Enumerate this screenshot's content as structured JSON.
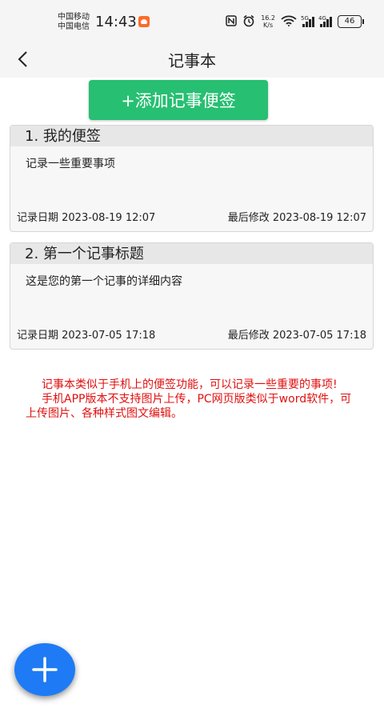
{
  "status_bar": {
    "carrier_1": "中国移动",
    "carrier_2": "中国电信",
    "time": "14:43",
    "speed_value": "16.2",
    "speed_unit": "K/s",
    "signal_1_label": "5G",
    "signal_2_label": "4G",
    "battery": "46"
  },
  "header": {
    "title": "记事本"
  },
  "add_button": {
    "label": "+添加记事便签",
    "color": "#27bf72"
  },
  "notes": [
    {
      "title": "1. 我的便签",
      "content": "记录一些重要事项",
      "record_date": "记录日期 2023-08-19 12:07",
      "modified_date": "最后修改 2023-08-19 12:07"
    },
    {
      "title": "2. 第一个记事标题",
      "content": "这是您的第一个记事的详细内容",
      "record_date": "记录日期 2023-07-05 17:18",
      "modified_date": "最后修改 2023-07-05 17:18"
    }
  ],
  "info": {
    "paragraph_1": "记事本类似于手机上的便签功能，可以记录一些重要的事项!",
    "paragraph_2": "手机APP版本不支持图片上传，PC网页版类似于word软件，可上传图片、各种样式图文编辑。",
    "color": "#e01010"
  },
  "fab": {
    "icon": "plus-icon",
    "color": "#1e7bf5"
  }
}
